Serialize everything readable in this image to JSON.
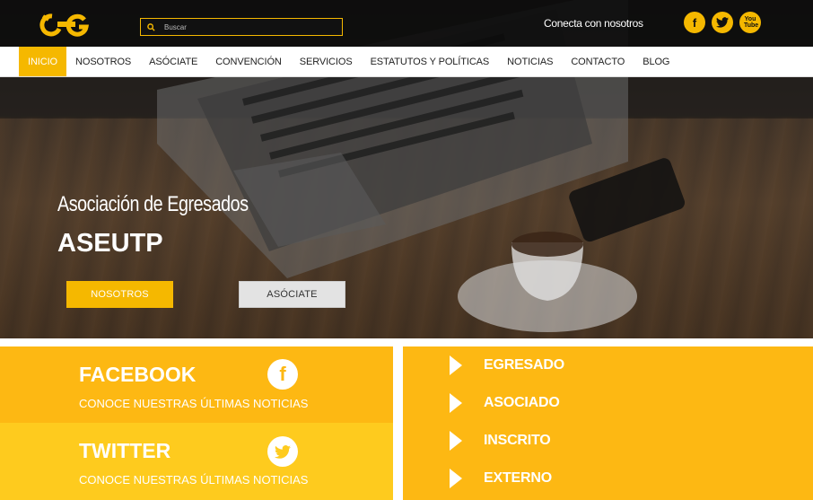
{
  "brand": {
    "logo_alt": "EG logo",
    "accent": "#f5b800"
  },
  "search": {
    "placeholder": "Buscar"
  },
  "header": {
    "connect_text": "Conecta con nosotros"
  },
  "social": [
    {
      "icon": "facebook-icon",
      "glyph": "f"
    },
    {
      "icon": "twitter-icon",
      "glyph": "t"
    },
    {
      "icon": "youtube-icon",
      "glyph": "You Tube"
    }
  ],
  "nav": {
    "items": [
      {
        "label": "INICIO",
        "active": true
      },
      {
        "label": "NOSOTROS"
      },
      {
        "label": "ASÓCIATE"
      },
      {
        "label": "CONVENCIÓN"
      },
      {
        "label": "SERVICIOS"
      },
      {
        "label": "ESTATUTOS Y POLÍTICAS"
      },
      {
        "label": "NOTICIAS"
      },
      {
        "label": "CONTACTO"
      },
      {
        "label": "BLOG"
      }
    ]
  },
  "hero": {
    "subtitle": "Asociación de Egresados",
    "title": "ASEUTP",
    "primary_button": "NOSOTROS",
    "secondary_button": "ASÓCIATE"
  },
  "cards": {
    "facebook": {
      "title": "FACEBOOK",
      "subtitle": "CONOCE NUESTRAS ÚLTIMAS NOTICIAS",
      "glyph": "f"
    },
    "twitter": {
      "title": "TWITTER",
      "subtitle": "CONOCE NUESTRAS ÚLTIMAS NOTICIAS"
    }
  },
  "links": [
    "EGRESADO",
    "ASOCIADO",
    "INSCRITO",
    "EXTERNO"
  ]
}
